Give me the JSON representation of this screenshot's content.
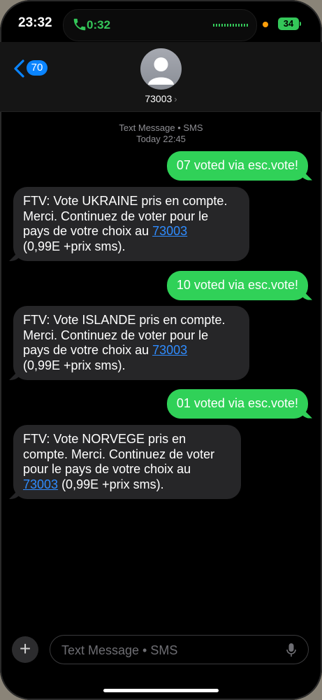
{
  "status_bar": {
    "time": "23:32",
    "call_timer": "0:32",
    "battery": "34"
  },
  "header": {
    "back_badge": "70",
    "contact": "73003",
    "chevron": "›"
  },
  "thread": {
    "service_label": "Text Message • SMS",
    "date_label": "Today 22:45"
  },
  "messages": [
    {
      "dir": "sent",
      "text": "07 voted via esc.vote!"
    },
    {
      "dir": "recv",
      "lines": [
        "FTV: Vote UKRAINE  pris en compte.",
        "Merci. Continuez de voter pour le",
        "pays de votre choix au "
      ],
      "link": "73003",
      "after": "(0,99E +prix sms)."
    },
    {
      "dir": "sent",
      "text": "10 voted via esc.vote!"
    },
    {
      "dir": "recv",
      "lines": [
        "FTV: Vote ISLANDE  pris en compte.",
        "Merci. Continuez de voter pour le",
        "pays de votre choix au "
      ],
      "link": "73003",
      "after": "(0,99E +prix sms)."
    },
    {
      "dir": "sent",
      "text": "01 voted via esc.vote!"
    },
    {
      "dir": "recv",
      "lines": [
        "FTV: Vote NORVEGE  pris en",
        "compte. Merci. Continuez de voter",
        "pour le pays de votre choix au"
      ],
      "link": "73003",
      "after": " (0,99E +prix sms)."
    }
  ],
  "composer": {
    "placeholder": "Text Message • SMS",
    "plus": "+"
  },
  "colors": {
    "sent_bubble": "#30d158",
    "recv_bubble": "#262628",
    "accent": "#0a84ff",
    "link": "#2f8cff"
  },
  "icons": [
    "phone-icon",
    "back-chevron-icon",
    "avatar-icon",
    "plus-icon",
    "microphone-icon"
  ]
}
